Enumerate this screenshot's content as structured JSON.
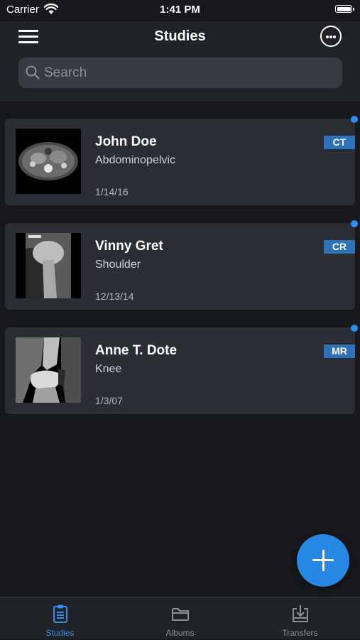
{
  "status_bar": {
    "carrier": "Carrier",
    "time": "1:41 PM"
  },
  "header": {
    "title": "Studies"
  },
  "search": {
    "placeholder": "Search"
  },
  "studies": [
    {
      "name": "John Doe",
      "description": "Abdominopelvic",
      "date": "1/14/16",
      "modality": "CT",
      "thumbnail_icon": "ct-scan-image"
    },
    {
      "name": "Vinny Gret",
      "description": "Shoulder",
      "date": "12/13/14",
      "modality": "CR",
      "thumbnail_icon": "xray-image"
    },
    {
      "name": "Anne T. Dote",
      "description": "Knee",
      "date": "1/3/07",
      "modality": "MR",
      "thumbnail_icon": "mri-image"
    }
  ],
  "tabs": [
    {
      "label": "Studies",
      "icon": "clipboard-icon",
      "active": true
    },
    {
      "label": "Albums",
      "icon": "folder-icon",
      "active": false
    },
    {
      "label": "Transfers",
      "icon": "download-tray-icon",
      "active": false
    }
  ],
  "colors": {
    "accent": "#2e8eee",
    "badge": "#2f71b8",
    "background": "#16181c",
    "card": "#2a2d33"
  }
}
